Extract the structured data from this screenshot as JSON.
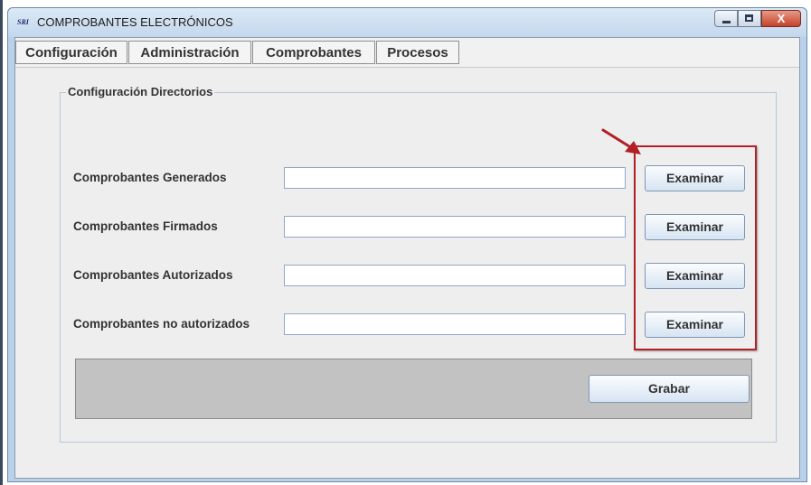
{
  "window": {
    "title": "COMPROBANTES ELECTRÓNICOS",
    "app_icon_text": "SRI",
    "close_glyph": "X"
  },
  "menu": {
    "items": [
      "Configuración",
      "Administración",
      "Comprobantes",
      "Procesos"
    ]
  },
  "group": {
    "title": "Configuración Directorios"
  },
  "rows": [
    {
      "label": "Comprobantes Generados",
      "value": "",
      "button": "Examinar"
    },
    {
      "label": "Comprobantes Firmados",
      "value": "",
      "button": "Examinar"
    },
    {
      "label": "Comprobantes Autorizados",
      "value": "",
      "button": "Examinar"
    },
    {
      "label": "Comprobantes no autorizados",
      "value": "",
      "button": "Examinar"
    }
  ],
  "actions": {
    "save_label": "Grabar"
  },
  "colors": {
    "highlight_border": "#b21f24",
    "titlebar": "#c3d7ec",
    "close_button": "#c4432c"
  }
}
